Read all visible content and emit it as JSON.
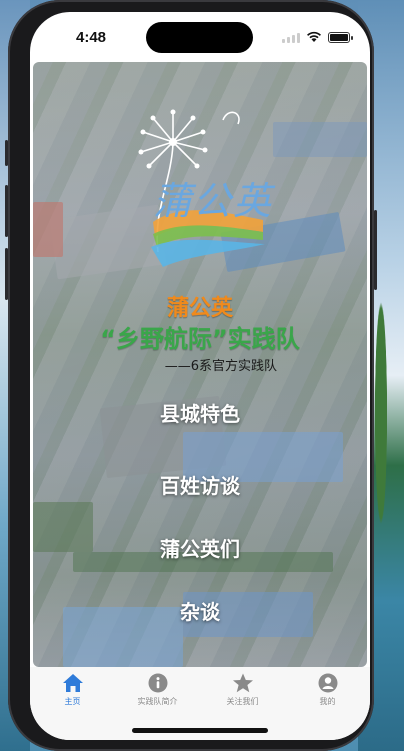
{
  "status_bar": {
    "time": "4:48"
  },
  "logo": {
    "text": "蒲公英"
  },
  "header": {
    "title": "蒲公英",
    "subtitle": "“乡野航际”实践队",
    "note": "——6系官方实践队"
  },
  "menu": {
    "items": [
      {
        "label": "县城特色"
      },
      {
        "label": "百姓访谈"
      },
      {
        "label": "蒲公英们"
      },
      {
        "label": "杂谈"
      }
    ]
  },
  "tab_bar": {
    "tabs": [
      {
        "label": "主页",
        "icon": "home-icon",
        "active": true
      },
      {
        "label": "实践队简介",
        "icon": "info-icon",
        "active": false
      },
      {
        "label": "关注我们",
        "icon": "star-icon",
        "active": false
      },
      {
        "label": "我的",
        "icon": "profile-icon",
        "active": false
      }
    ]
  },
  "colors": {
    "accent": "#2f7bd9",
    "title_orange": "#f08a1c",
    "subtitle_green": "#3aa64a",
    "inactive_tab": "#8a8a8a"
  }
}
